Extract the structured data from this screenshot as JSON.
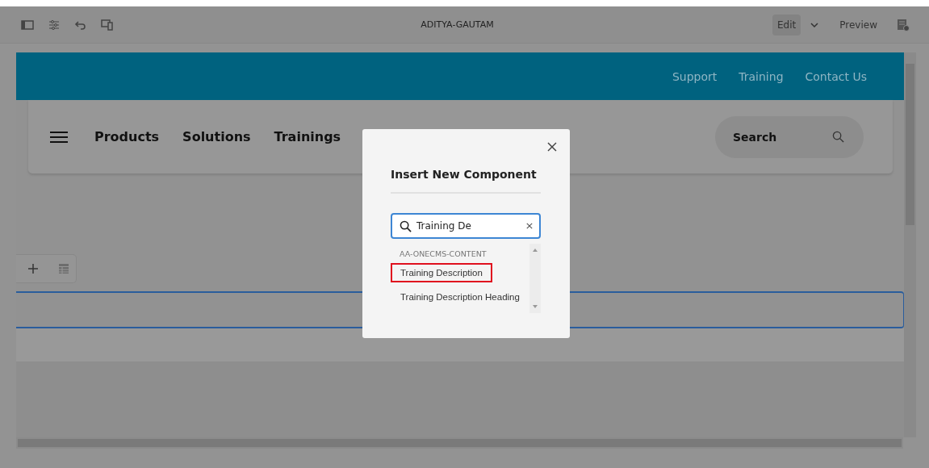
{
  "toolbar": {
    "title": "ADITYA-GAUTAM",
    "modes": [
      {
        "label": "Edit",
        "selected": true
      },
      {
        "label": "Preview",
        "selected": false
      }
    ]
  },
  "header": {
    "links": [
      "Support",
      "Training",
      "Contact Us"
    ]
  },
  "nav": {
    "items": [
      "Products",
      "Solutions",
      "Trainings"
    ],
    "search": {
      "placeholder": "Search"
    }
  },
  "dialog": {
    "title": "Insert New Component",
    "search": {
      "value": "Training De"
    },
    "group": "AA-ONECMS-CONTENT",
    "items": [
      {
        "label": "Training Description",
        "highlighted": true
      },
      {
        "label": "Training Description Heading",
        "highlighted": false
      }
    ]
  }
}
